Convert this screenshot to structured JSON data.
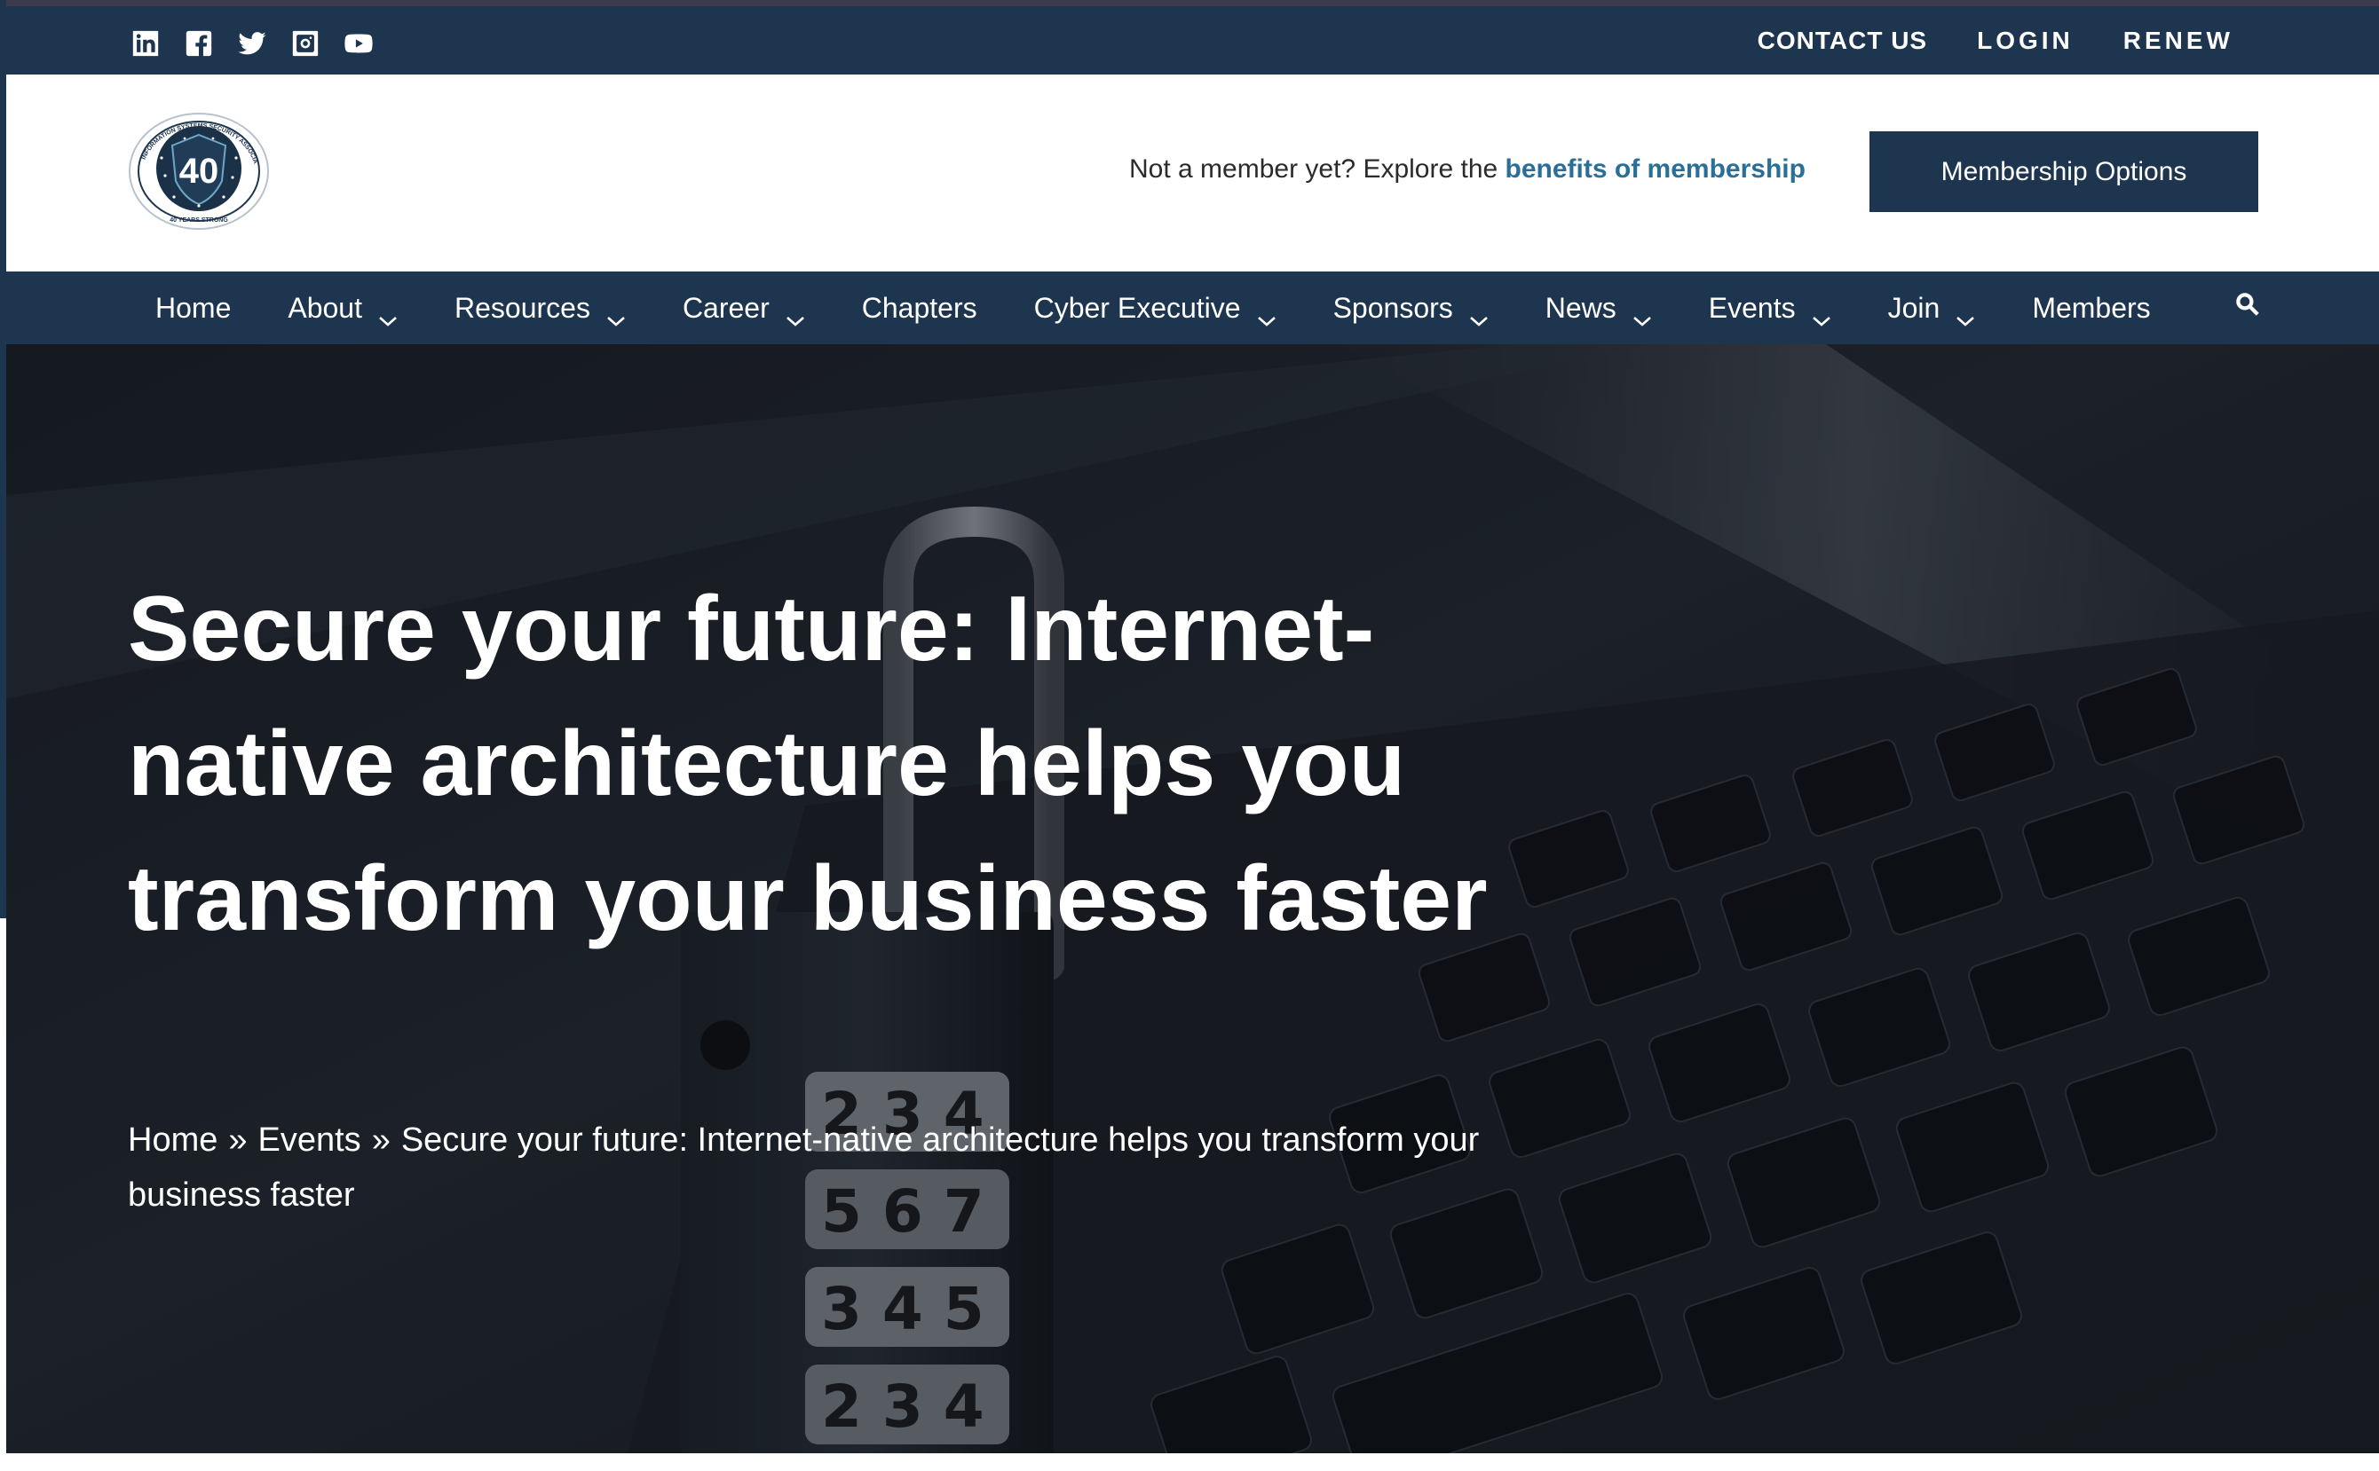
{
  "utility": {
    "social_icons": [
      "linkedin-icon",
      "facebook-icon",
      "twitter-icon",
      "instagram-icon",
      "youtube-icon"
    ],
    "contact_label": "CONTACT US",
    "login_label": "LOGIN",
    "renew_label": "RENEW"
  },
  "header": {
    "logo_text": "40",
    "logo_ring_text": "INFORMATION SYSTEMS SECURITY ASSOCIATION",
    "logo_bottom_text": "40 YEARS STRONG",
    "promo_prefix": "Not a member yet? Explore the ",
    "promo_link": "benefits of membership",
    "membership_button": "Membership Options"
  },
  "nav": {
    "items": [
      {
        "label": "Home",
        "dropdown": false
      },
      {
        "label": "About",
        "dropdown": true
      },
      {
        "label": "Resources",
        "dropdown": true
      },
      {
        "label": "Career",
        "dropdown": true
      },
      {
        "label": "Chapters",
        "dropdown": false
      },
      {
        "label": "Cyber Executive",
        "dropdown": true
      },
      {
        "label": "Sponsors",
        "dropdown": true
      },
      {
        "label": "News",
        "dropdown": true
      },
      {
        "label": "Events",
        "dropdown": true
      },
      {
        "label": "Join",
        "dropdown": true
      },
      {
        "label": "Members",
        "dropdown": false
      }
    ],
    "search_icon": "search-icon"
  },
  "hero": {
    "title": "Secure your future: Internet-native architecture helps you transform your business faster",
    "breadcrumb": {
      "home": "Home",
      "separator": "»",
      "events": "Events",
      "current": "Secure your future: Internet-native architecture helps you transform your business faster"
    }
  },
  "colors": {
    "brand_navy": "#1e3550",
    "link_blue": "#2a6f97",
    "white": "#ffffff"
  }
}
